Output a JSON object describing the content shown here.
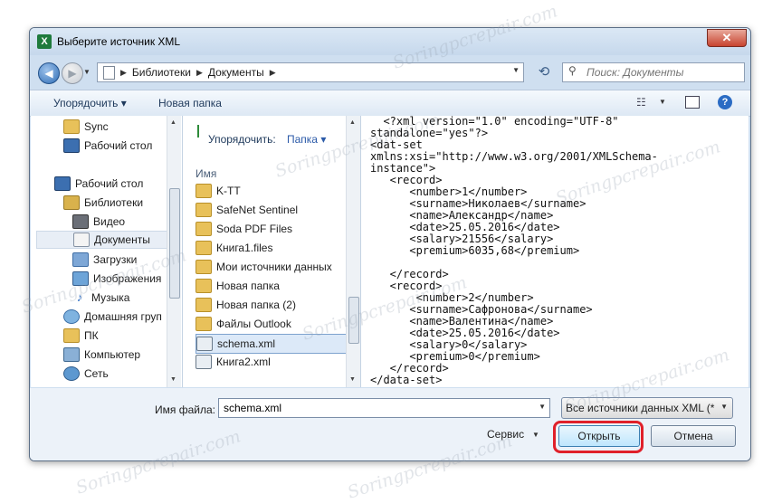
{
  "window": {
    "title": "Выберите источник XML",
    "close_symbol": "✕"
  },
  "nav": {
    "back_symbol": "◀",
    "forward_symbol": "▶",
    "breadcrumb": [
      "Библиотеки",
      "Документы"
    ],
    "search_placeholder": "Поиск: Документы"
  },
  "toolbar": {
    "organize": "Упорядочить ▾",
    "new_folder": "Новая папка",
    "help": "?"
  },
  "sidebar": {
    "items": [
      {
        "label": "Sync",
        "icon": "folder-icon"
      },
      {
        "label": "Рабочий стол",
        "icon": "desktop-icon"
      },
      {
        "label": "Рабочий стол",
        "icon": "desktop-icon"
      },
      {
        "label": "Библиотеки",
        "icon": "libraries-icon"
      },
      {
        "label": "Видео",
        "icon": "video-icon"
      },
      {
        "label": "Документы",
        "icon": "documents-icon",
        "selected": true
      },
      {
        "label": "Загрузки",
        "icon": "downloads-icon"
      },
      {
        "label": "Изображения",
        "icon": "pictures-icon"
      },
      {
        "label": "Музыка",
        "icon": "music-icon"
      },
      {
        "label": "Домашняя груп",
        "icon": "homegroup-icon"
      },
      {
        "label": "ПК",
        "icon": "computer-icon"
      },
      {
        "label": "Компьютер",
        "icon": "computer-icon"
      },
      {
        "label": "Сеть",
        "icon": "network-icon"
      }
    ]
  },
  "filelist": {
    "arrange_label": "Упорядочить:",
    "arrange_value": "Папка ▾",
    "column_name": "Имя",
    "items": [
      {
        "label": "K-TT",
        "icon": "folder-icon"
      },
      {
        "label": "SafeNet Sentinel",
        "icon": "folder-icon"
      },
      {
        "label": "Soda PDF Files",
        "icon": "folder-icon"
      },
      {
        "label": "Книга1.files",
        "icon": "folder-icon"
      },
      {
        "label": "Мои источники данных",
        "icon": "data-sources-folder-icon"
      },
      {
        "label": "Новая папка",
        "icon": "folder-icon"
      },
      {
        "label": "Новая папка (2)",
        "icon": "folder-icon"
      },
      {
        "label": "Файлы Outlook",
        "icon": "folder-icon"
      },
      {
        "label": "schema.xml",
        "icon": "xml-file-icon",
        "selected": true
      },
      {
        "label": "Книга2.xml",
        "icon": "xml-file-icon"
      }
    ]
  },
  "preview": {
    "xml": "  <?xml version=\"1.0\" encoding=\"UTF-8\"\nstandalone=\"yes\"?>\n<dat-set\nxmlns:xsi=\"http://www.w3.org/2001/XMLSchema-\ninstance\">\n   <record>\n      <number>1</number>\n      <surname>Николаев</surname>\n      <name>Александр</name>\n      <date>25.05.2016</date>\n      <salary>21556</salary>\n      <premium>6035,68</premium>\n\n   </record>\n   <record>\n       <number>2</number>\n      <surname>Сафронова</surname>\n      <name>Валентина</name>\n      <date>25.05.2016</date>\n      <salary>0</salary>\n      <premium>0</premium>\n   </record>\n</data-set>"
  },
  "footer": {
    "filename_label": "Имя файла:",
    "filename_value": "schema.xml",
    "filter_value": "Все источники данных XML (*",
    "service_label": "Сервис",
    "open_label": "Открыть",
    "cancel_label": "Отмена"
  },
  "watermark": "Soringpcrepair.com",
  "colors": {
    "highlight": "#e0202a",
    "selection": "#dce9f8",
    "frame": "#cfdff0"
  }
}
